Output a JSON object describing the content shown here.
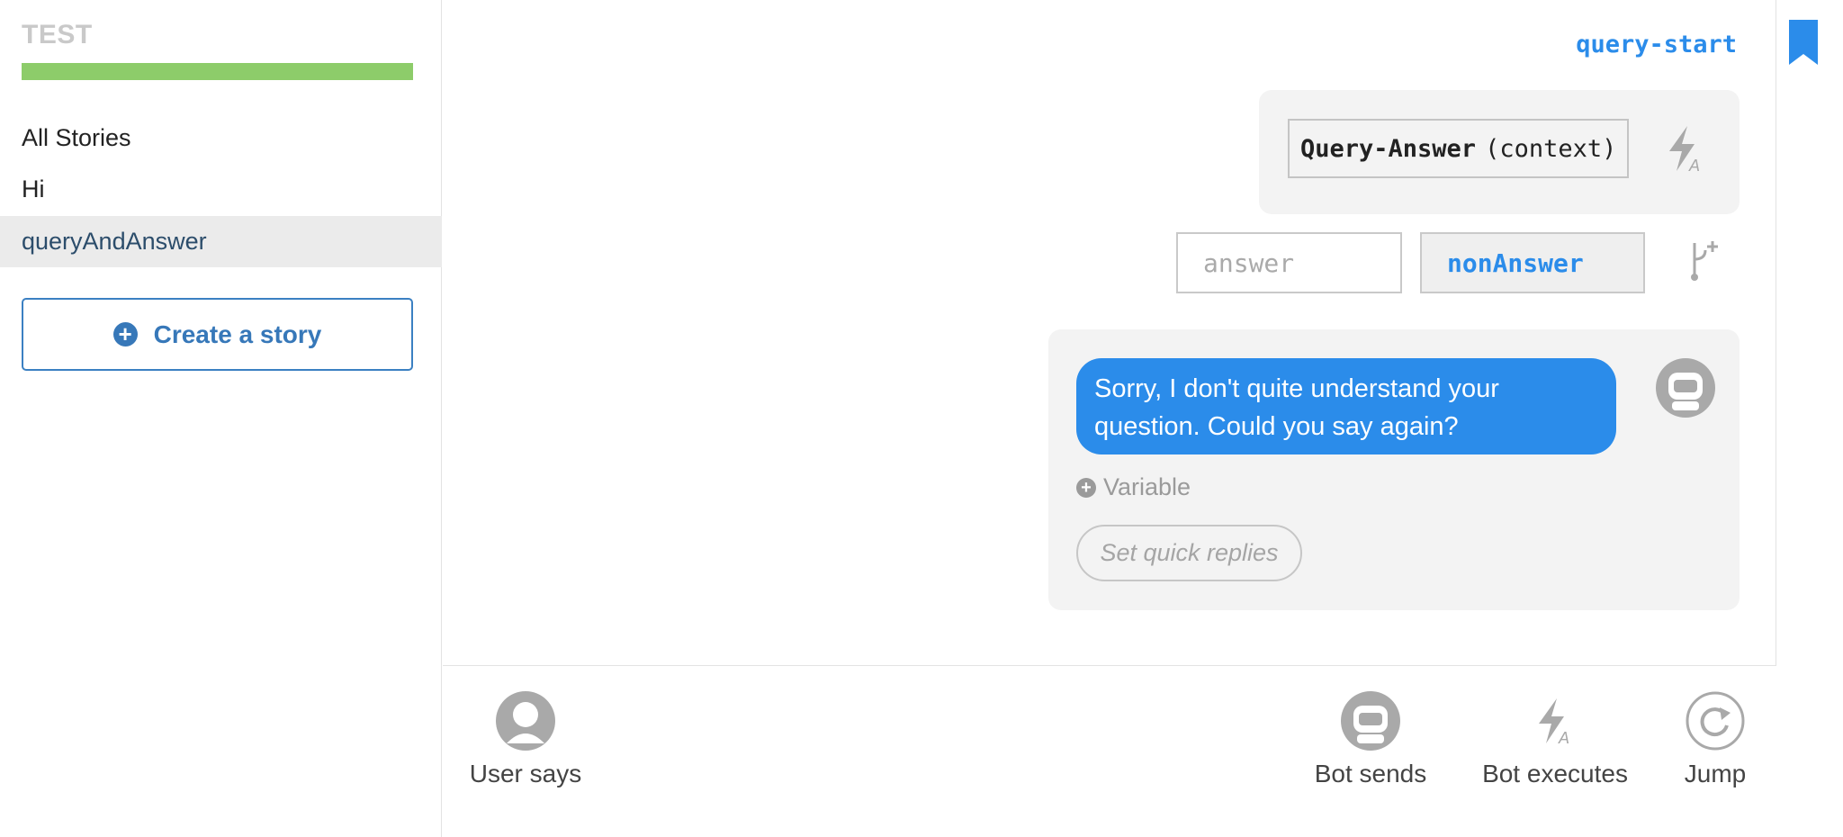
{
  "sidebar": {
    "project_title": "TEST",
    "stories_heading": "All Stories",
    "stories": [
      {
        "label": "Hi",
        "active": false
      },
      {
        "label": "queryAndAnswer",
        "active": true
      }
    ],
    "create_story_label": "Create a story"
  },
  "canvas": {
    "label": "query-start",
    "action": {
      "function_name": "Query-Answer",
      "args": "(context)",
      "icon": "bolt-icon"
    },
    "conditions": [
      {
        "label": "answer",
        "selected": false
      },
      {
        "label": "nonAnswer",
        "selected": true
      }
    ],
    "bot_message": {
      "text": "Sorry, I don't quite understand your question. Could you say again?",
      "variable_label": "Variable",
      "quick_replies_placeholder": "Set quick replies"
    }
  },
  "toolbar": {
    "user_says": "User says",
    "bot_sends": "Bot sends",
    "bot_executes": "Bot executes",
    "jump": "Jump"
  },
  "colors": {
    "accent": "#2b8cea",
    "progress": "#8dcc6a",
    "button_border": "#3b80c2",
    "card_bg": "#f3f3f3"
  }
}
